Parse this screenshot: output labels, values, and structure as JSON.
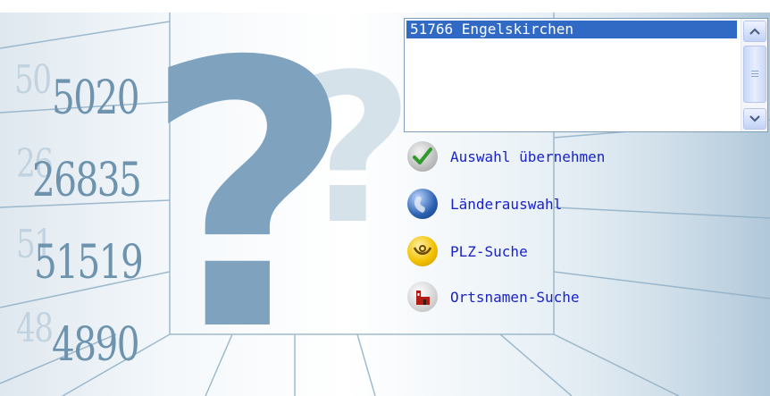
{
  "background": {
    "numbers": [
      "5020",
      "26835",
      "51519",
      "4890"
    ],
    "ghost_numbers": [
      "50",
      "26",
      "51",
      "48"
    ],
    "question_mark": "?"
  },
  "listbox": {
    "items": [
      "51766 Engelskirchen"
    ],
    "selected": "51766 Engelskirchen"
  },
  "actions": [
    {
      "label": "Auswahl übernehmen",
      "icon": "checkmark-icon"
    },
    {
      "label": "Länderauswahl",
      "icon": "globe-icon"
    },
    {
      "label": "PLZ-Suche",
      "icon": "post-horn-icon"
    },
    {
      "label": "Ortsnamen-Suche",
      "icon": "town-church-icon"
    }
  ],
  "colors": {
    "selection": "#316ac5",
    "link": "#1a23c8",
    "accent": "#6e93ae"
  }
}
